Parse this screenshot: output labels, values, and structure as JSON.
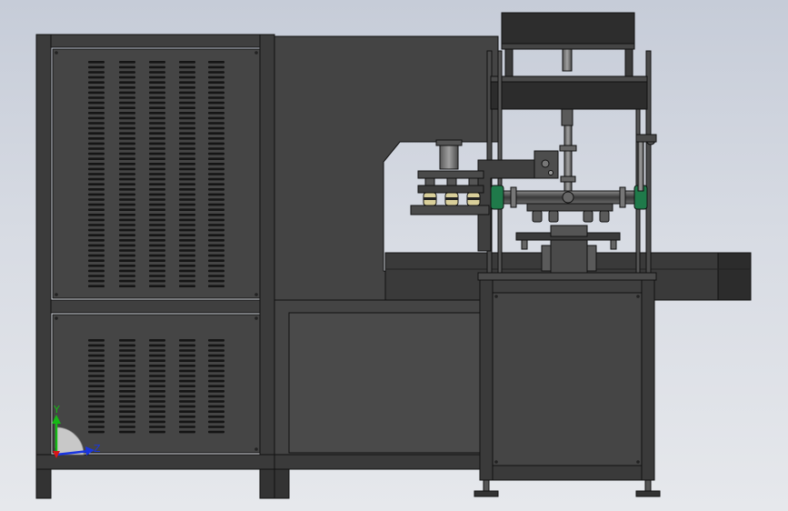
{
  "triad": {
    "y_label": "Y",
    "z_label": "Z",
    "colors": {
      "y": "#16b816",
      "z": "#1a36e0",
      "x": "#d81818"
    }
  },
  "colors": {
    "body": "#454545",
    "body_dark": "#2b2b2b",
    "edge": "#111111",
    "frame": "#3d3d3d",
    "accent_green": "#1f7a4a",
    "cream": "#d9cf9a"
  }
}
